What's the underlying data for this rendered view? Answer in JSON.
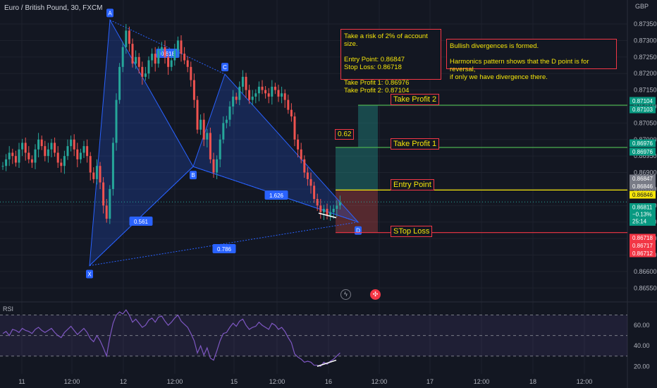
{
  "ticker": "Euro / British Pound, 30, FXCM",
  "currency": "GBP",
  "indicator": "RSI",
  "colors": {
    "bg": "#131722",
    "up": "#26a69a",
    "down": "#ef5350",
    "pattern": "#2962ff",
    "tp": "#26a69a",
    "entry": "#f5e50a",
    "sl": "#f23645"
  },
  "notes": {
    "risk": "Take a risk of 2% of account size.\n\nEntry Point: 0.86847\nStop Loss: 0.86718\n\nTake Profit 1: 0.86976\nTake Profit 2: 0.87104",
    "divergence": "Bullish divergences is formed.\n\nHarmonics pattern shows that the D point is for reversal,\n if only we have divergence there."
  },
  "level_labels": {
    "tp2": "Take Profit 2",
    "tp1": "Take Profit 1",
    "entry": "Entry Point",
    "sl": "STop Loss",
    "ratio": "0.62"
  },
  "price_badges": [
    {
      "text": "0.87104",
      "color": "#089981"
    },
    {
      "text": "0.87103",
      "color": "#089981"
    },
    {
      "text": "0.86976",
      "color": "#089981"
    },
    {
      "text": "0.86976",
      "color": "#089981"
    },
    {
      "text": "0.86847",
      "color": "#787b86"
    },
    {
      "text": "0.86846",
      "color": "#787b86"
    },
    {
      "text": "0.86846",
      "color": "#f5e50a"
    },
    {
      "text": "0.86811\n−0.13%\n25:14",
      "color": "#089981"
    },
    {
      "text": "0.86718",
      "color": "#f23645"
    },
    {
      "text": "0.86717",
      "color": "#f23645"
    },
    {
      "text": "0.86712",
      "color": "#f23645"
    }
  ],
  "chart_data": [
    {
      "type": "candlestick",
      "title": "Euro / British Pound, 30, FXCM",
      "y_ticks": [
        "0.87350",
        "0.87300",
        "0.87250",
        "0.87200",
        "0.87150",
        "0.87100",
        "0.87050",
        "0.87000",
        "0.86950",
        "0.86900",
        "0.86850",
        "0.86800",
        "0.86750",
        "0.86700",
        "0.86650",
        "0.86600",
        "0.86550"
      ],
      "x_ticks": [
        "11",
        "12:00",
        "12",
        "12:00",
        "15",
        "12:00",
        "16",
        "12:00",
        "17",
        "12:00",
        "18",
        "12:00"
      ],
      "ylim": [
        0.86525,
        0.8738
      ],
      "ohlc_close": [
        0.8692,
        0.8694,
        0.8696,
        0.8695,
        0.8693,
        0.8697,
        0.8699,
        0.8696,
        0.8694,
        0.8693,
        0.8697,
        0.87,
        0.8698,
        0.8695,
        0.8697,
        0.8699,
        0.8696,
        0.8693,
        0.8692,
        0.8695,
        0.8698,
        0.87,
        0.8697,
        0.8694,
        0.8696,
        0.8698,
        0.8695,
        0.869,
        0.8688,
        0.8692,
        0.8687,
        0.868,
        0.8676,
        0.8685,
        0.8699,
        0.8712,
        0.8722,
        0.8728,
        0.8733,
        0.8729,
        0.8723,
        0.8725,
        0.8722,
        0.8719,
        0.872,
        0.8724,
        0.8726,
        0.8723,
        0.8727,
        0.8728,
        0.8725,
        0.8722,
        0.8724,
        0.8727,
        0.873,
        0.8726,
        0.8724,
        0.8722,
        0.8718,
        0.8712,
        0.8703,
        0.8706,
        0.87,
        0.8702,
        0.8694,
        0.869,
        0.8694,
        0.87,
        0.8705,
        0.8706,
        0.871,
        0.8713,
        0.8712,
        0.8716,
        0.8719,
        0.8715,
        0.8712,
        0.8713,
        0.8714,
        0.8716,
        0.8715,
        0.8714,
        0.8713,
        0.8716,
        0.8715,
        0.8713,
        0.8714,
        0.8712,
        0.8709,
        0.8707,
        0.87,
        0.8697,
        0.8694,
        0.869,
        0.8688,
        0.8686,
        0.8682,
        0.868,
        0.8678,
        0.8679,
        0.8677,
        0.8678,
        0.8679,
        0.868,
        0.8681
      ],
      "pattern_points": [
        {
          "label": "X",
          "price": 0.86618
        },
        {
          "label": "A",
          "price": 0.87362
        },
        {
          "label": "B",
          "price": 0.86918
        },
        {
          "label": "C",
          "price": 0.87198
        },
        {
          "label": "D",
          "price": 0.8675
        }
      ],
      "pattern_ratios": [
        "0.618",
        "0.561",
        "1.626",
        "0.786"
      ],
      "levels": {
        "take_profit_2": 0.87104,
        "take_profit_1": 0.86976,
        "entry": 0.86847,
        "stop_loss": 0.86718,
        "current": 0.86811
      }
    },
    {
      "type": "line",
      "title": "RSI",
      "y_ticks": [
        "60.00",
        "40.00",
        "20.00"
      ],
      "ylim": [
        14,
        80
      ],
      "bands": [
        70,
        50,
        30
      ],
      "values": [
        52,
        54,
        50,
        56,
        55,
        53,
        57,
        55,
        54,
        52,
        56,
        58,
        55,
        53,
        55,
        57,
        53,
        50,
        48,
        53,
        56,
        59,
        55,
        51,
        54,
        57,
        53,
        47,
        44,
        50,
        45,
        38,
        30,
        48,
        62,
        70,
        73,
        71,
        75,
        70,
        63,
        66,
        62,
        58,
        60,
        65,
        67,
        63,
        68,
        69,
        64,
        60,
        63,
        67,
        70,
        64,
        61,
        58,
        52,
        45,
        33,
        40,
        31,
        38,
        28,
        26,
        35,
        45,
        52,
        53,
        58,
        62,
        59,
        64,
        66,
        60,
        56,
        58,
        59,
        63,
        60,
        58,
        56,
        62,
        60,
        56,
        58,
        54,
        48,
        43,
        32,
        29,
        27,
        24,
        25,
        24,
        21,
        21,
        20,
        24,
        22,
        25,
        27,
        30,
        33
      ]
    }
  ]
}
